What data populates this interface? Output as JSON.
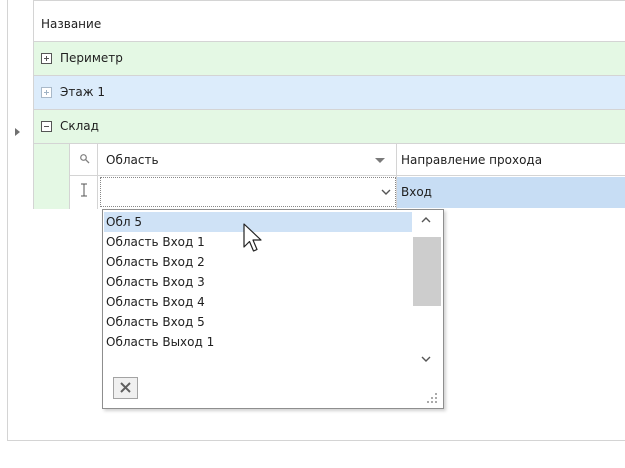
{
  "grid": {
    "column_header": "Название",
    "rows": [
      {
        "label": "Периметр",
        "expander": "plus"
      },
      {
        "label": "Этаж 1",
        "expander": "plus"
      },
      {
        "label": "Склад",
        "expander": "minus"
      }
    ]
  },
  "detail": {
    "columns": [
      "Область",
      "Направление прохода"
    ],
    "editor_value": "",
    "direction_value": "Вход"
  },
  "dropdown": {
    "items": [
      "Обл 5",
      "Область Вход 1",
      "Область Вход 2",
      "Область Вход 3",
      "Область Вход 4",
      "Область Вход 5",
      "Область Выход 1"
    ],
    "selected_index": 0,
    "clear_icon": "close-icon"
  },
  "colors": {
    "row_green": "#e4f8e4",
    "row_blue": "#dcecfb",
    "selected_item": "#cfe2f6",
    "selected_cell": "#c7ddf4",
    "scroll_thumb": "#cdcdcd"
  }
}
